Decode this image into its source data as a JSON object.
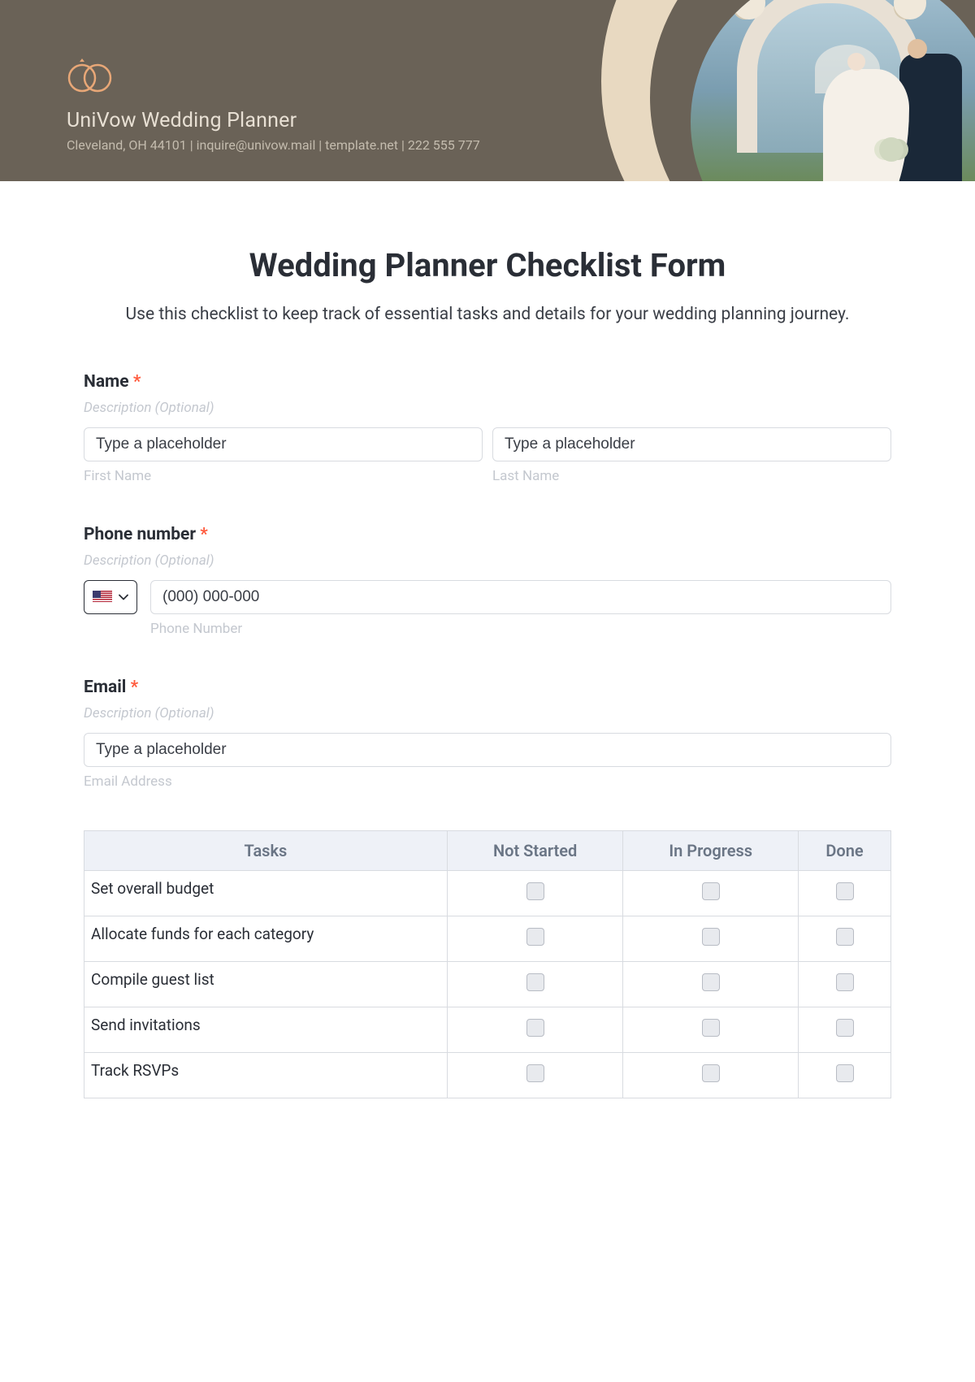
{
  "header": {
    "company_name": "UniVow Wedding Planner",
    "contact_line": "Cleveland, OH 44101 | inquire@univow.mail | template.net | 222 555 777"
  },
  "form": {
    "title": "Wedding Planner Checklist Form",
    "description": "Use this checklist to keep track of essential tasks and details for your wedding planning journey."
  },
  "fields": {
    "name": {
      "label": "Name",
      "sub": "Description (Optional)",
      "first_placeholder": "Type a placeholder",
      "first_sublabel": "First Name",
      "last_placeholder": "Type a placeholder",
      "last_sublabel": "Last Name"
    },
    "phone": {
      "label": "Phone number",
      "sub": "Description (Optional)",
      "placeholder": "(000) 000-000",
      "sublabel": "Phone Number"
    },
    "email": {
      "label": "Email",
      "sub": "Description (Optional)",
      "placeholder": "Type a placeholder",
      "sublabel": "Email Address"
    }
  },
  "table": {
    "headers": {
      "tasks": "Tasks",
      "not_started": "Not Started",
      "in_progress": "In Progress",
      "done": "Done"
    },
    "rows": [
      "Set overall budget",
      "Allocate funds for each category",
      "Compile guest list",
      "Send invitations",
      "Track RSVPs"
    ]
  },
  "required_marker": "*"
}
